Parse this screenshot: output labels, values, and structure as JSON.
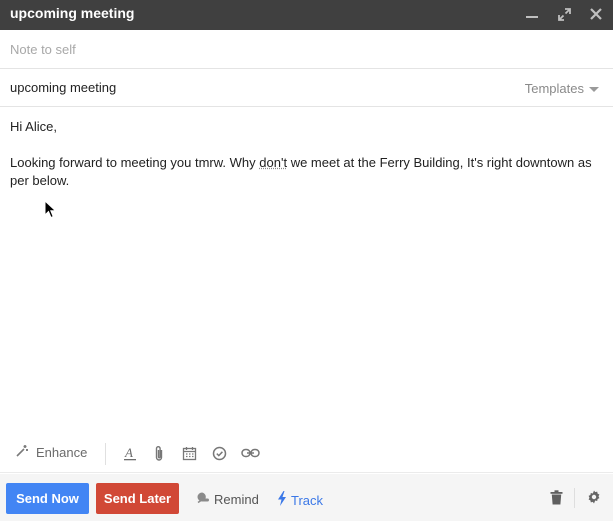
{
  "window": {
    "title": "upcoming meeting",
    "controls": {
      "minimize_icon": "minimize-icon",
      "expand_icon": "expand-icon",
      "close_icon": "close-icon"
    }
  },
  "compose": {
    "to_placeholder": "Note to self",
    "subject": "upcoming meeting",
    "templates_label": "Templates",
    "body": {
      "greeting": "Hi Alice,",
      "line_part1": "Looking forward to meeting you tmrw. Why ",
      "misspelled_word": "don't",
      "line_part2": " we meet at the Ferry Building, It's right downtown as per below."
    }
  },
  "formatting_toolbar": {
    "enhance_label": "Enhance",
    "icons": [
      "magic-wand-icon",
      "text-format-icon",
      "attach-icon",
      "calendar-icon",
      "checkmark-icon",
      "link-icon"
    ]
  },
  "action_bar": {
    "send_now_label": "Send Now",
    "send_later_label": "Send Later",
    "remind_label": "Remind",
    "track_label": "Track",
    "icons": [
      "remind-icon",
      "bolt-icon",
      "trash-icon",
      "gear-icon"
    ]
  },
  "colors": {
    "titlebar": "#404040",
    "send_now": "#4285f4",
    "send_later": "#d14836",
    "track": "#3b78e7"
  }
}
